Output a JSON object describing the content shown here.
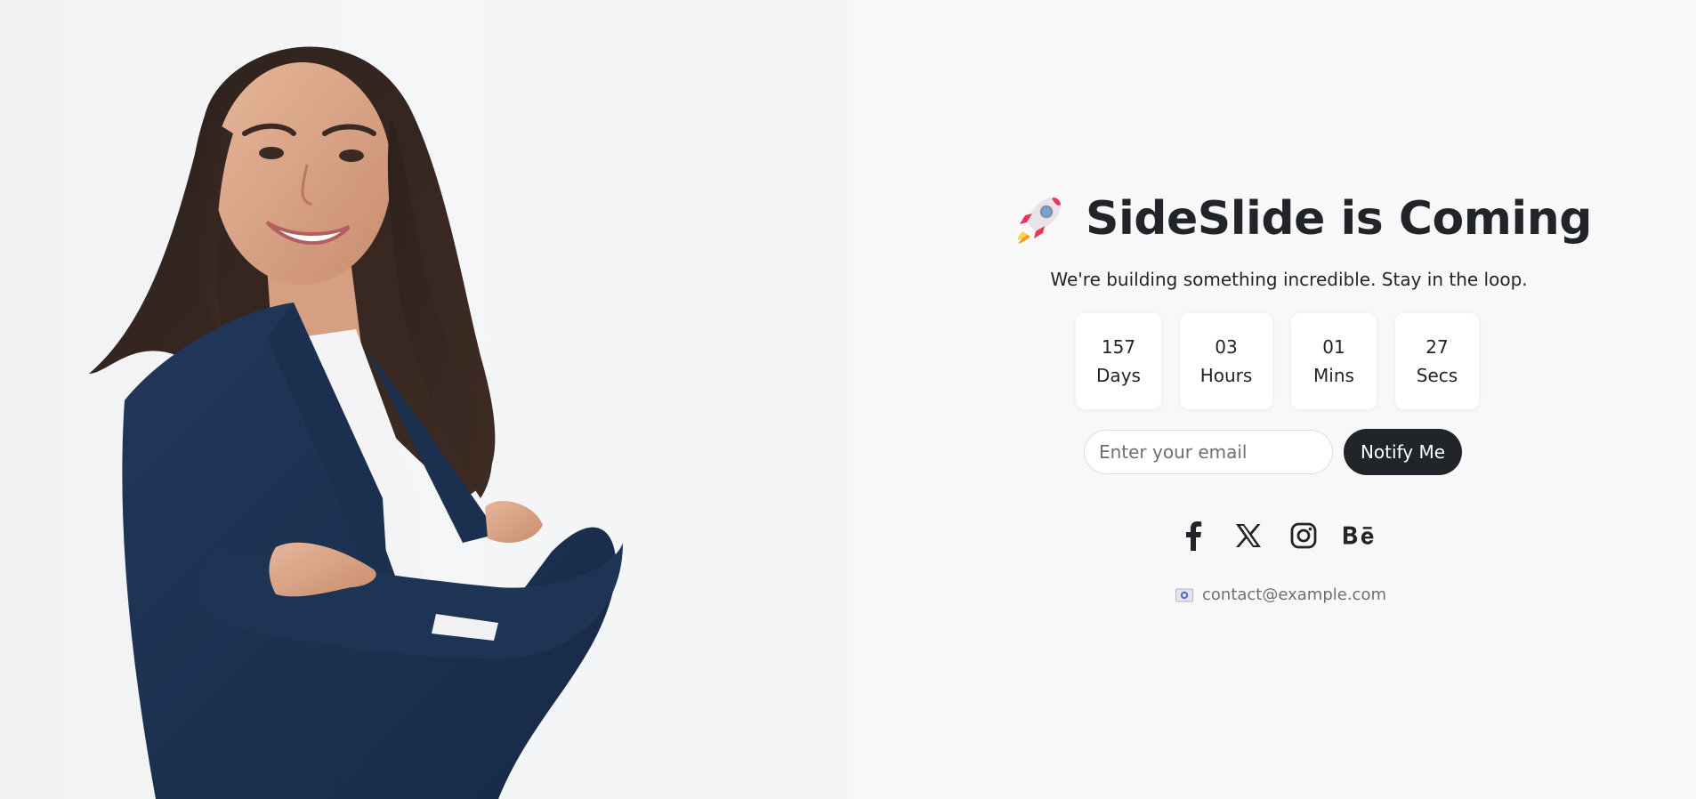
{
  "brand": {
    "title": "SideSlide is Coming",
    "subtitle": "We're building something incredible. Stay in the loop."
  },
  "countdown": [
    {
      "value": "157",
      "unit": "Days"
    },
    {
      "value": "03",
      "unit": "Hours"
    },
    {
      "value": "01",
      "unit": "Mins"
    },
    {
      "value": "27",
      "unit": "Secs"
    }
  ],
  "signup": {
    "email_placeholder": "Enter your email",
    "email_value": "",
    "button_label": "Notify Me"
  },
  "social": [
    {
      "name": "facebook-icon"
    },
    {
      "name": "x-icon"
    },
    {
      "name": "instagram-icon"
    },
    {
      "name": "behance-icon"
    }
  ],
  "contact": {
    "email": "contact@example.com",
    "icon": "envelope-icon"
  },
  "colors": {
    "background": "#f8f8f8",
    "text": "#212529",
    "button": "#212529",
    "muted": "#6c6f73"
  }
}
